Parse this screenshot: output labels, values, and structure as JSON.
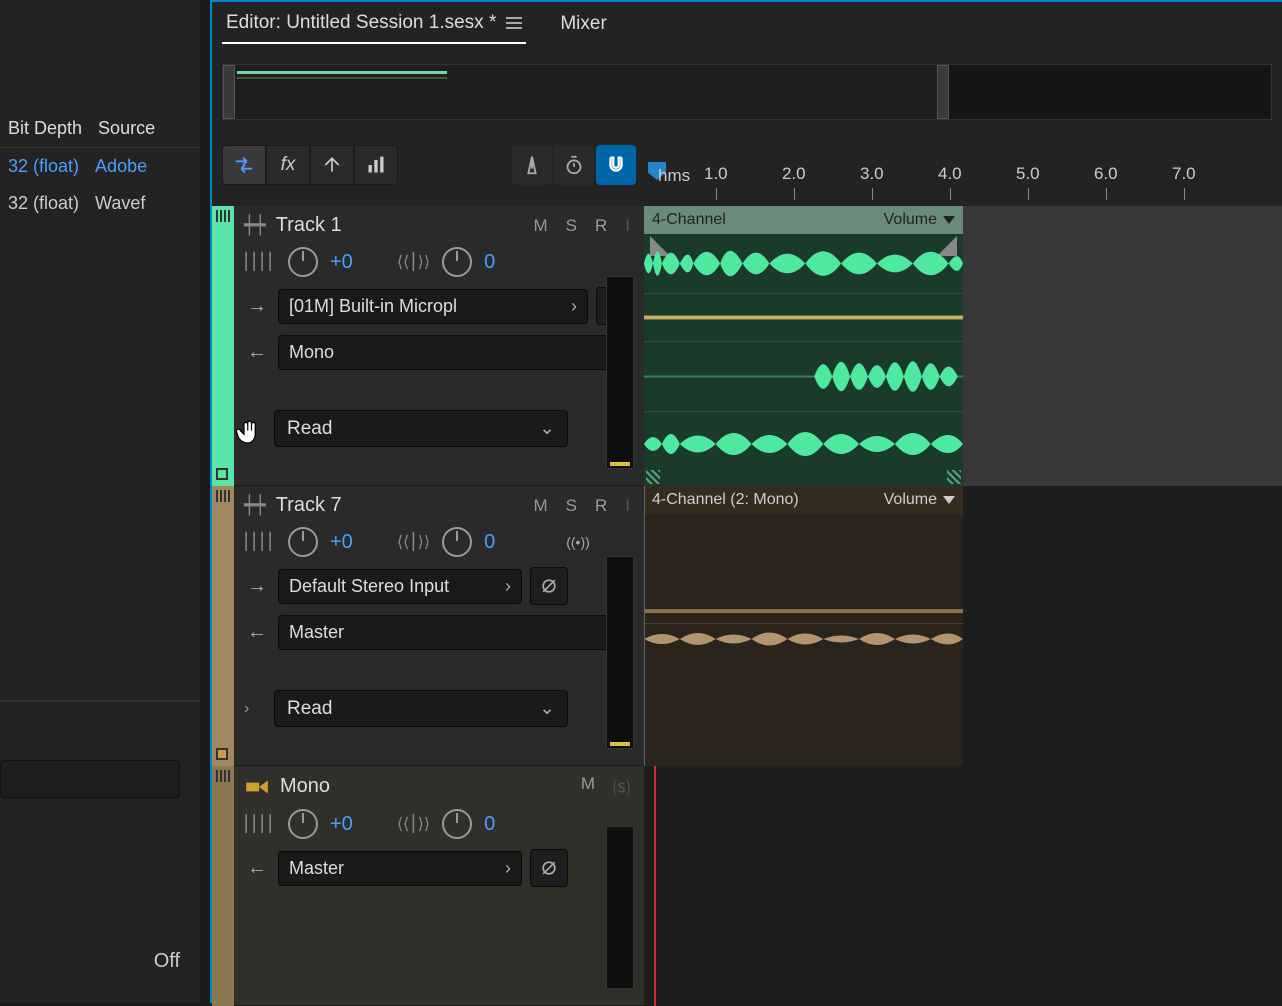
{
  "tabs": {
    "editor": "Editor: Untitled Session 1.sesx *",
    "mixer": "Mixer"
  },
  "left": {
    "col1": "Bit Depth",
    "col2": "Source",
    "row1_c1": "32 (float)",
    "row1_c2": "Adobe",
    "row2_c1": "32 (float)",
    "row2_c2": "Wavef",
    "off": "Off"
  },
  "ruler": {
    "unit": "hms",
    "ticks": [
      "1.0",
      "2.0",
      "3.0",
      "4.0",
      "5.0",
      "6.0",
      "7.0"
    ]
  },
  "track1": {
    "name": "Track 1",
    "m": "M",
    "s": "S",
    "r": "R",
    "i": "I",
    "vol": "+0",
    "pan": "0",
    "input": "[01M] Built-in Micropl",
    "output": "Mono",
    "automation": "Read",
    "clip_name": "4-Channel",
    "clip_prop": "Volume"
  },
  "track7": {
    "name": "Track 7",
    "m": "M",
    "s": "S",
    "r": "R",
    "i": "I",
    "vol": "+0",
    "pan": "0",
    "input": "Default Stereo Input",
    "output": "Master",
    "automation": "Read",
    "clip_name": "4-Channel (2: Mono)",
    "clip_prop": "Volume"
  },
  "bus": {
    "name": "Mono",
    "m": "M",
    "s": "⒮",
    "vol": "+0",
    "pan": "0",
    "output": "Master"
  }
}
